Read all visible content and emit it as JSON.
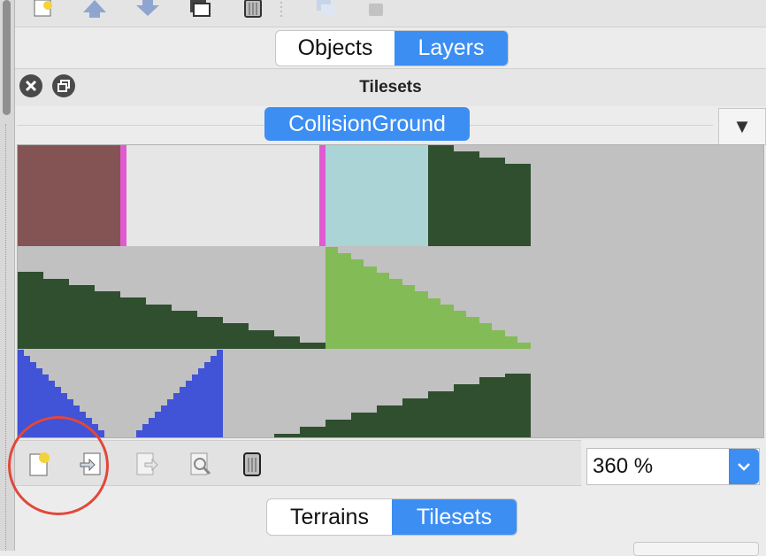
{
  "top_toolbar": {
    "icons": [
      "new-layer-icon",
      "raise-layer-icon",
      "lower-layer-icon",
      "duplicate-layer-icon",
      "delete-layer-icon",
      "separator",
      "layer-visibility-icon",
      "lock-icon"
    ]
  },
  "panel_switch": {
    "options": [
      "Objects",
      "Layers"
    ],
    "selected": "Layers"
  },
  "tilesets_dock": {
    "title": "Tilesets",
    "active_tab": "CollisionGround",
    "tab_menu_glyph": "▼",
    "close_icon": "close-icon",
    "float_icon": "float-icon"
  },
  "tile_view": {
    "colors": {
      "background": "#c1c1c1",
      "brown": "#845454",
      "pink": "#e05ad0",
      "light_gray": "#e6e6e6",
      "cyan": "#aad4d6",
      "dark_green": "#2f4f2f",
      "light_green": "#83bb57",
      "blue": "#4153d6"
    }
  },
  "tileset_toolbar": {
    "icons": [
      "new-tileset-icon",
      "import-tileset-icon",
      "export-tileset-icon",
      "edit-tileset-icon",
      "remove-tileset-icon"
    ],
    "zoom_value": "360 %"
  },
  "bottom_switch": {
    "options": [
      "Terrains",
      "Tilesets"
    ],
    "selected": "Tilesets"
  },
  "annotation": {
    "color": "#e2473a"
  }
}
